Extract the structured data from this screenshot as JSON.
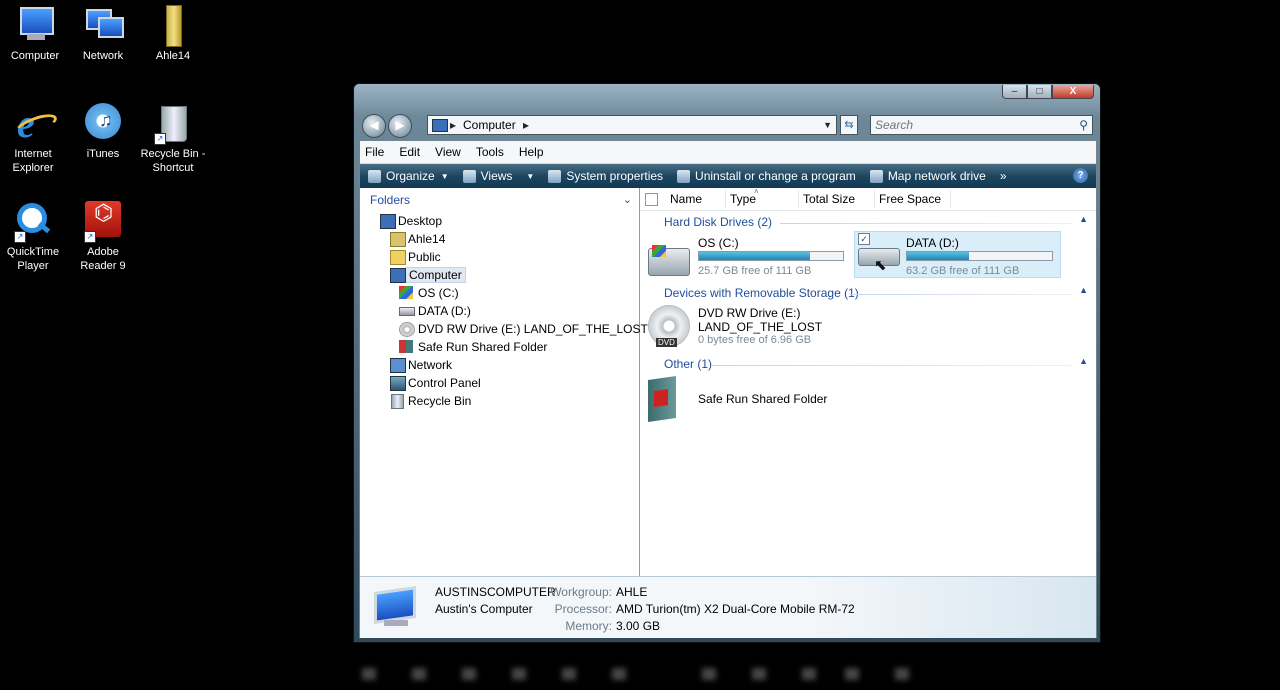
{
  "desktop": {
    "icons": [
      {
        "label_1": "Computer",
        "label_2": "",
        "icon": "computer-icon"
      },
      {
        "label_1": "Network",
        "label_2": "",
        "icon": "network-icon"
      },
      {
        "label_1": "Ahle14",
        "label_2": "",
        "icon": "user-folder-icon"
      },
      {
        "label_1": "Internet",
        "label_2": "Explorer",
        "icon": "internet-explorer-icon"
      },
      {
        "label_1": "iTunes",
        "label_2": "",
        "icon": "itunes-icon"
      },
      {
        "label_1": "Recycle Bin -",
        "label_2": "Shortcut",
        "icon": "recycle-bin-icon"
      },
      {
        "label_1": "QuickTime",
        "label_2": "Player",
        "icon": "quicktime-icon"
      },
      {
        "label_1": "Adobe",
        "label_2": "Reader 9",
        "icon": "adobe-reader-icon"
      }
    ]
  },
  "window": {
    "caption": {
      "min": "–",
      "max": "□",
      "close": "X"
    },
    "address": {
      "text": "Computer"
    },
    "search": {
      "placeholder": "Search"
    },
    "menu": [
      "File",
      "Edit",
      "View",
      "Tools",
      "Help"
    ],
    "commands": [
      {
        "label": "Organize",
        "dropdown": true
      },
      {
        "label": "Views",
        "dropdown": true
      },
      {
        "label": "System properties",
        "dropdown": false
      },
      {
        "label": "Uninstall or change a program",
        "dropdown": false
      },
      {
        "label": "Map network drive",
        "dropdown": false
      }
    ],
    "more": "»",
    "help": "?"
  },
  "folders": {
    "title": "Folders",
    "tree": [
      {
        "label": "Desktop",
        "level": 0,
        "icon": "desktop-icon",
        "selected": false
      },
      {
        "label": "Ahle14",
        "level": 1,
        "icon": "user-folder-icon",
        "selected": false
      },
      {
        "label": "Public",
        "level": 1,
        "icon": "folder-icon",
        "selected": false
      },
      {
        "label": "Computer",
        "level": 1,
        "icon": "computer-icon",
        "selected": true
      },
      {
        "label": "OS (C:)",
        "level": 2,
        "icon": "windows-drive-icon",
        "selected": false
      },
      {
        "label": "DATA (D:)",
        "level": 2,
        "icon": "hard-drive-icon",
        "selected": false
      },
      {
        "label": "DVD RW Drive (E:) LAND_OF_THE_LOST",
        "level": 2,
        "icon": "dvd-drive-icon",
        "selected": false
      },
      {
        "label": "Safe Run Shared Folder",
        "level": 2,
        "icon": "shared-folder-icon",
        "selected": false
      },
      {
        "label": "Network",
        "level": 1,
        "icon": "network-icon",
        "selected": false
      },
      {
        "label": "Control Panel",
        "level": 1,
        "icon": "control-panel-icon",
        "selected": false
      },
      {
        "label": "Recycle Bin",
        "level": 1,
        "icon": "recycle-bin-icon",
        "selected": false
      }
    ]
  },
  "columns": [
    "Name",
    "Type",
    "Total Size",
    "Free Space"
  ],
  "groups": {
    "hdd": "Hard Disk Drives (2)",
    "removable": "Devices with Removable Storage (1)",
    "other": "Other (1)"
  },
  "drives": {
    "c": {
      "name": "OS (C:)",
      "free_text": "25.7 GB free of 111 GB",
      "used_fraction": 0.77
    },
    "d": {
      "name": "DATA (D:)",
      "free_text": "63.2 GB free of 111 GB",
      "used_fraction": 0.43
    },
    "e": {
      "name": "DVD RW Drive (E:)",
      "label": "LAND_OF_THE_LOST",
      "free_text": "0 bytes free of 6.96 GB",
      "badge": "DVD"
    },
    "other": {
      "name": "Safe Run Shared Folder"
    }
  },
  "details": {
    "computer_name": "AUSTINSCOMPUTER",
    "description": "Austin's Computer",
    "workgroup_label": "Workgroup:",
    "workgroup": "AHLE",
    "processor_label": "Processor:",
    "processor": "AMD Turion(tm) X2 Dual-Core Mobile RM-72",
    "memory_label": "Memory:",
    "memory": "3.00 GB"
  },
  "colors": {
    "accent": "#1f4e9c",
    "command_bar": "#1d4660",
    "bar_fill": "#1e86b5"
  }
}
